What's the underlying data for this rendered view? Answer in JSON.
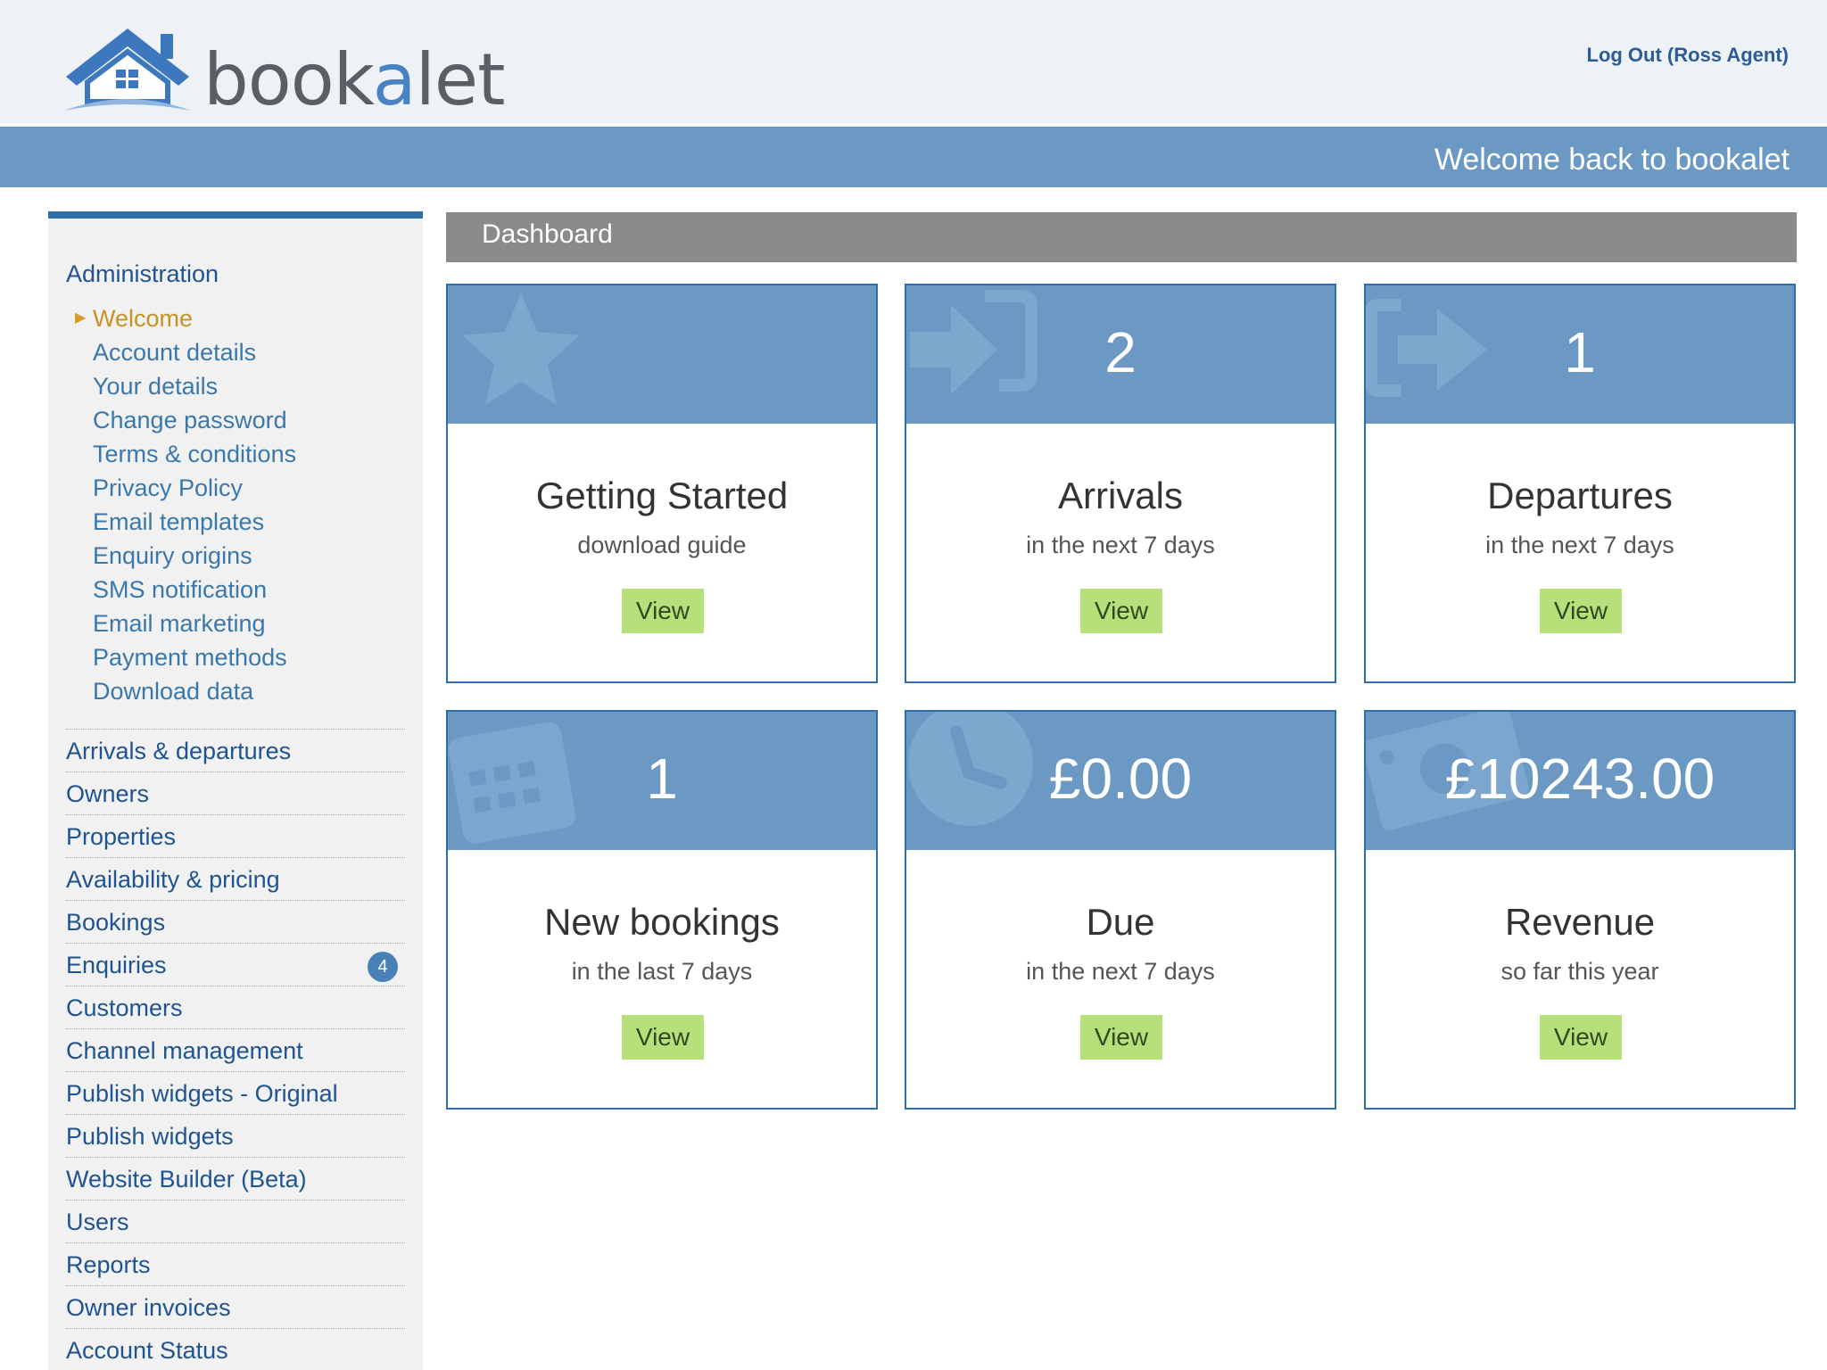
{
  "header": {
    "logo_text_a": "book",
    "logo_text_b": "a",
    "logo_text_c": "let",
    "logout_label": "Log Out (Ross Agent)",
    "welcome_text": "Welcome back to bookalet"
  },
  "sidebar": {
    "section_title": "Administration",
    "subitems": [
      {
        "label": "Welcome",
        "active": true
      },
      {
        "label": "Account details"
      },
      {
        "label": "Your details"
      },
      {
        "label": "Change password"
      },
      {
        "label": "Terms & conditions"
      },
      {
        "label": "Privacy Policy"
      },
      {
        "label": "Email templates"
      },
      {
        "label": "Enquiry origins"
      },
      {
        "label": "SMS notification"
      },
      {
        "label": "Email marketing"
      },
      {
        "label": "Payment methods"
      },
      {
        "label": "Download data"
      }
    ],
    "items": [
      {
        "label": "Arrivals & departures"
      },
      {
        "label": "Owners"
      },
      {
        "label": "Properties"
      },
      {
        "label": "Availability & pricing"
      },
      {
        "label": "Bookings"
      },
      {
        "label": "Enquiries",
        "badge": "4"
      },
      {
        "label": "Customers"
      },
      {
        "label": "Channel management"
      },
      {
        "label": "Publish widgets - Original"
      },
      {
        "label": "Publish widgets"
      },
      {
        "label": "Website Builder (Beta)"
      },
      {
        "label": "Users"
      },
      {
        "label": "Reports"
      },
      {
        "label": "Owner invoices"
      },
      {
        "label": "Account Status"
      }
    ]
  },
  "dashboard": {
    "title": "Dashboard",
    "cards": [
      {
        "icon": "star-icon",
        "value": "",
        "title": "Getting Started",
        "subtitle": "download guide",
        "button": "View"
      },
      {
        "icon": "arrival-icon",
        "value": "2",
        "title": "Arrivals",
        "subtitle": "in the next 7 days",
        "button": "View"
      },
      {
        "icon": "departure-icon",
        "value": "1",
        "title": "Departures",
        "subtitle": "in the next 7 days",
        "button": "View"
      },
      {
        "icon": "calendar-icon",
        "value": "1",
        "title": "New bookings",
        "subtitle": "in the last 7 days",
        "button": "View"
      },
      {
        "icon": "clock-icon",
        "value": "£0.00",
        "title": "Due",
        "subtitle": "in the next 7 days",
        "button": "View"
      },
      {
        "icon": "money-icon",
        "value": "£10243.00",
        "title": "Revenue",
        "subtitle": "so far this year",
        "button": "View"
      }
    ]
  },
  "colors": {
    "brand_blue": "#6b99c4",
    "nav_link": "#1f5490",
    "active_link": "#c89220",
    "button_green": "#b8e07a"
  }
}
